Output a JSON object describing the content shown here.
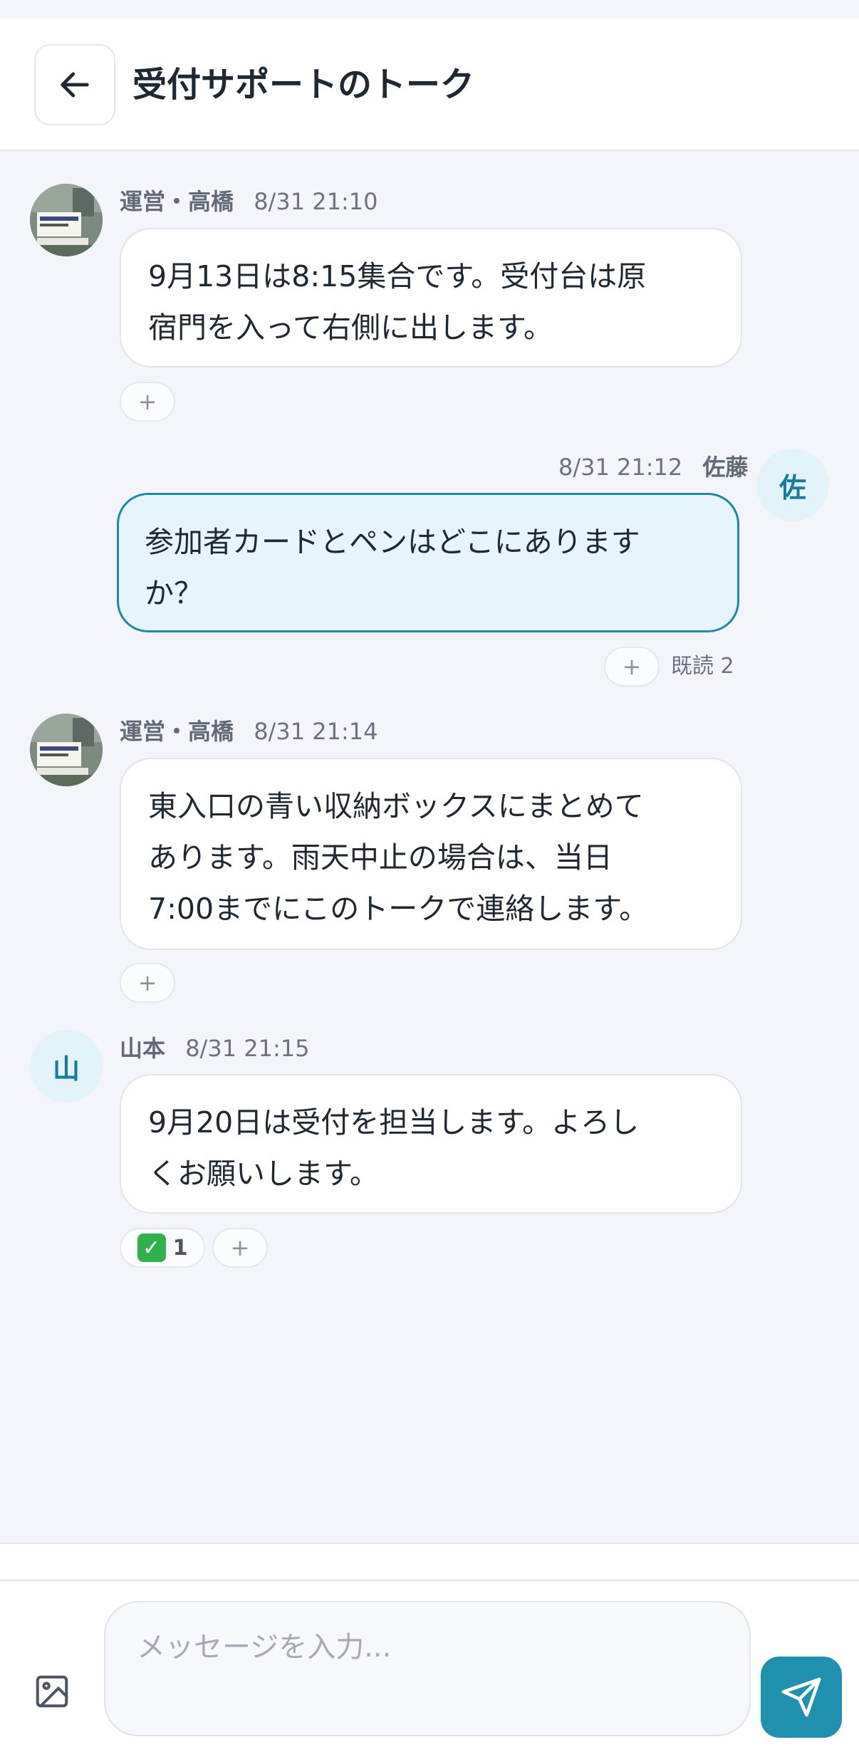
{
  "header": {
    "title": "受付サポートのトーク",
    "back_icon": "arrow-left-icon"
  },
  "messages": [
    {
      "sender": "運営・高橋",
      "time": "8/31 21:10",
      "avatar": "photo",
      "text": [
        "9月13日は8:15集合です。受付台は原",
        "宿門を入って右側に出します。"
      ],
      "reactions": [],
      "add_reaction": "+"
    },
    {
      "sender": "佐藤",
      "time": "8/31 21:12",
      "avatar_initial": "佐",
      "mine": true,
      "text": [
        "参加者カードとペンはどこにあります",
        "か？"
      ],
      "add_reaction": "+",
      "read_receipt": "既読 2"
    },
    {
      "sender": "運営・高橋",
      "time": "8/31 21:14",
      "avatar": "photo",
      "text": [
        "東入口の青い収納ボックスにまとめて",
        "あります。雨天中止の場合は、当日",
        "7:00までにこのトークで連絡します。"
      ],
      "add_reaction": "+"
    },
    {
      "sender": "山本",
      "time": "8/31 21:15",
      "avatar_initial": "山",
      "text": [
        "9月20日は受付を担当します。よろし",
        "くお願いします。"
      ],
      "reactions": [
        {
          "emoji": "✅",
          "count": "1"
        }
      ],
      "add_reaction": "+"
    }
  ],
  "composer": {
    "placeholder": "メッセージを入力...",
    "image_icon": "image-icon",
    "send_icon": "send-icon"
  },
  "colors": {
    "accent": "#1f90ad",
    "mine_bubble_bg": "#e6f5fb",
    "mine_bubble_border": "#1d89a8",
    "background": "#f3f5fa"
  }
}
